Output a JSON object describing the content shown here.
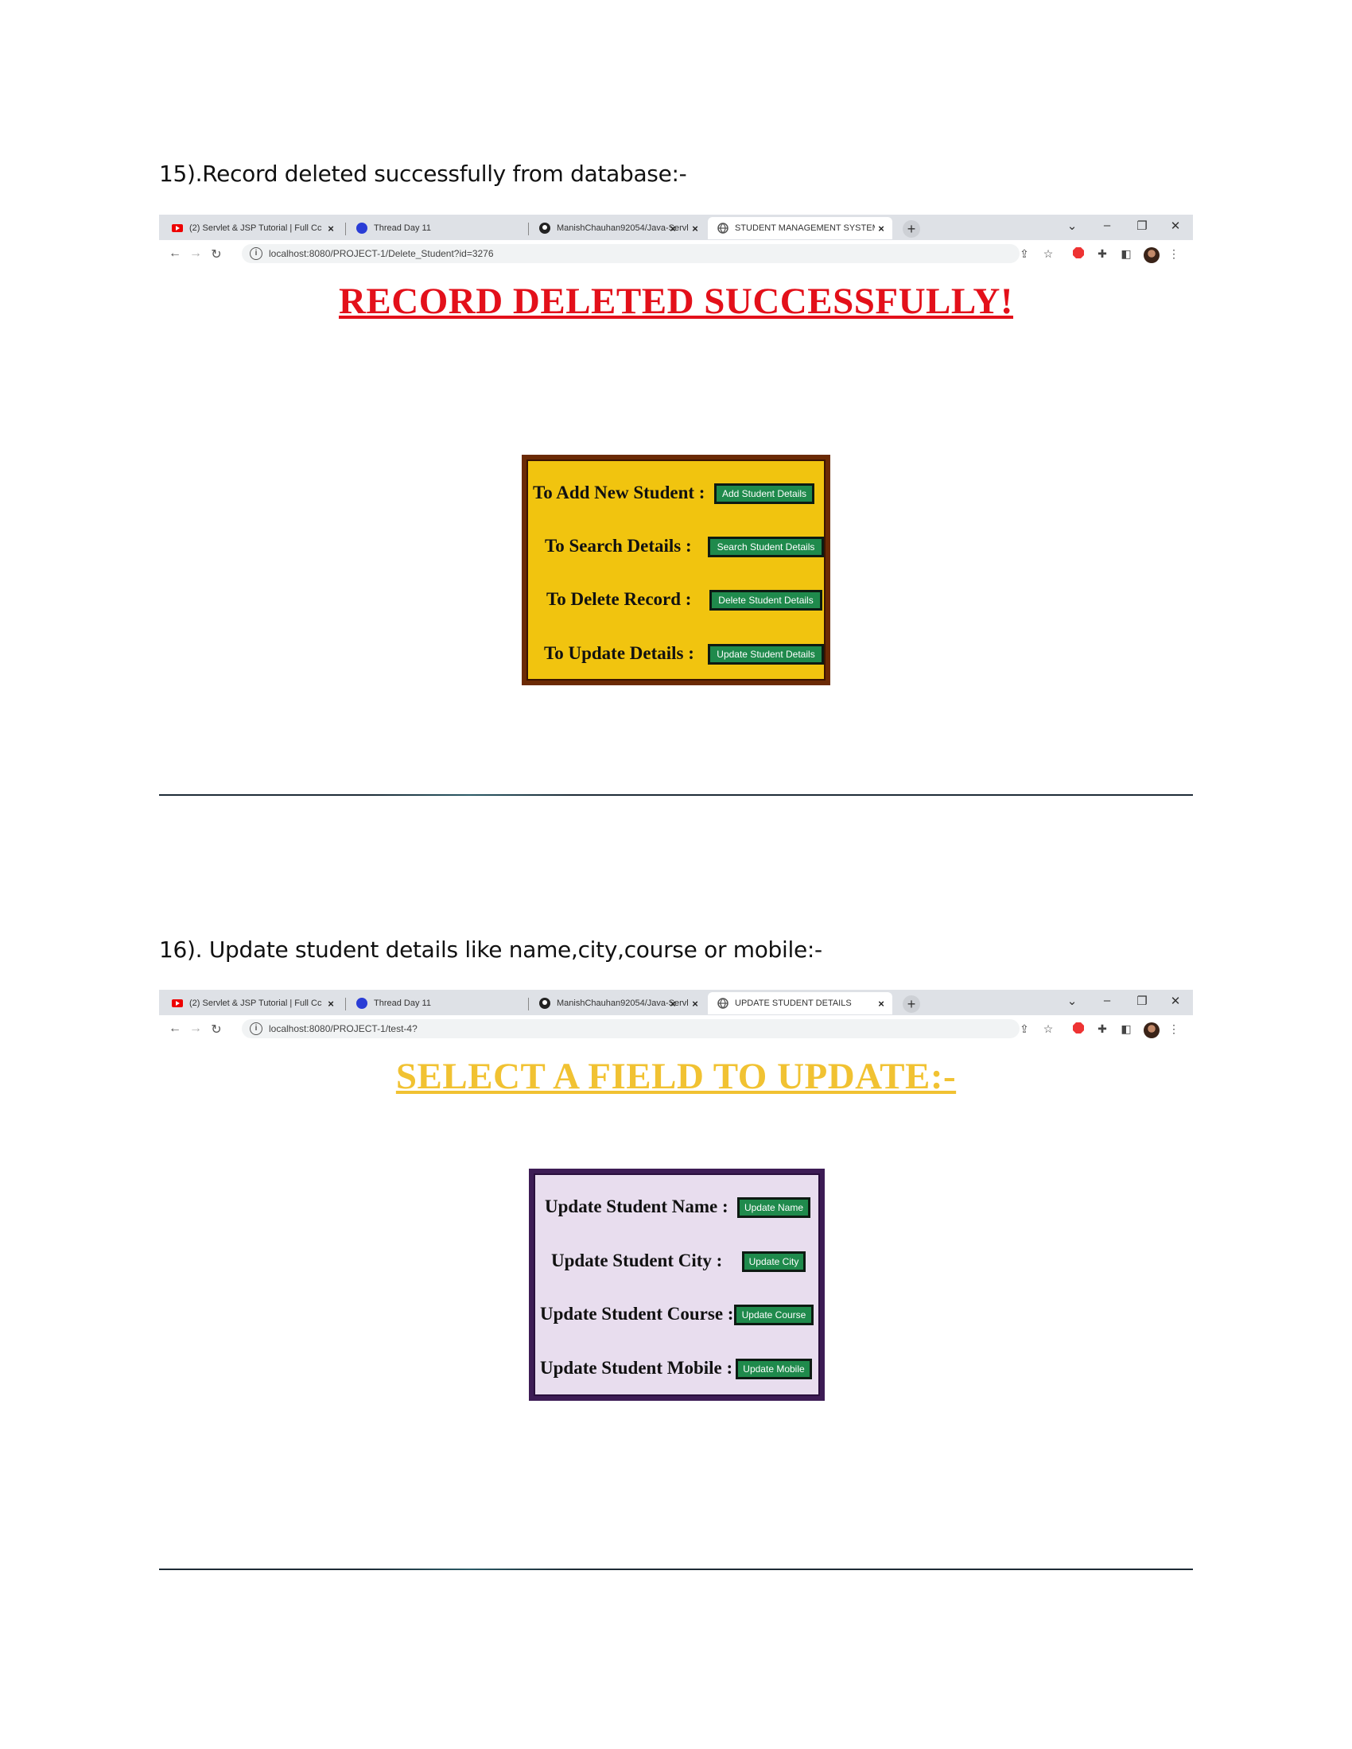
{
  "captions": {
    "first": "15).Record deleted successfully from database:-",
    "second": "16). Update student details like name,city,course or mobile:-"
  },
  "browser1": {
    "tabs": [
      {
        "label": "(2) Servlet & JSP Tutorial | Full Cc",
        "icon": "youtube-icon"
      },
      {
        "label": "Thread Day 11",
        "icon": "blue-logo-icon"
      },
      {
        "label": "ManishChauhan92054/Java-Servl",
        "icon": "github-icon"
      },
      {
        "label": "STUDENT MANAGEMENT SYSTEM",
        "icon": "globe-icon"
      }
    ],
    "new_tab": "+",
    "url": "localhost:8080/PROJECT-1/Delete_Student?id=3276"
  },
  "page1": {
    "heading": "RECORD DELETED SUCCESSFULLY!",
    "heading_color": "#e3101a",
    "panel_bg": "#f1c40f",
    "panel_border": "#6b2a05",
    "rows": [
      {
        "label": "To Add New Student :",
        "button": "Add Student Details"
      },
      {
        "label": "To Search Details :",
        "button": "Search Student Details"
      },
      {
        "label": "To Delete Record :",
        "button": "Delete Student Details"
      },
      {
        "label": "To Update Details :",
        "button": "Update Student Details"
      }
    ]
  },
  "browser2": {
    "tabs": [
      {
        "label": "(2) Servlet & JSP Tutorial | Full Cc",
        "icon": "youtube-icon"
      },
      {
        "label": "Thread Day 11",
        "icon": "blue-logo-icon"
      },
      {
        "label": "ManishChauhan92054/Java-Servl",
        "icon": "github-icon"
      },
      {
        "label": "UPDATE STUDENT DETAILS",
        "icon": "globe-icon"
      }
    ],
    "new_tab": "+",
    "url": "localhost:8080/PROJECT-1/test-4?"
  },
  "page2": {
    "heading": "SELECT A FIELD TO UPDATE:-",
    "heading_color": "#f1c232",
    "panel_bg": "#e8ddee",
    "panel_border": "#3d1c55",
    "rows": [
      {
        "label": "Update Student Name :",
        "button": "Update Name"
      },
      {
        "label": "Update Student City :",
        "button": "Update City"
      },
      {
        "label": "Update Student Course :",
        "button": "Update Course"
      },
      {
        "label": "Update Student Mobile :",
        "button": "Update Mobile"
      }
    ]
  },
  "button_color": "#1f8a4c"
}
